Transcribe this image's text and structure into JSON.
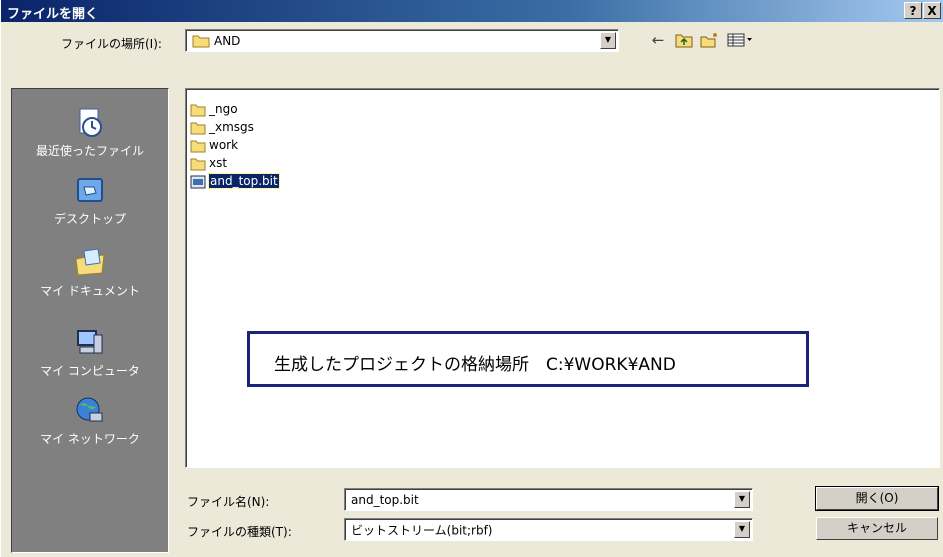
{
  "window": {
    "title": "ファイルを開く",
    "help_btn": "?",
    "close_btn": "X"
  },
  "location": {
    "label": "ファイルの場所(I):",
    "value": "AND"
  },
  "toolbar": {
    "back_icon": "←",
    "up_icon": "⇡",
    "new_folder_icon": "✳",
    "view_icon": "▦▾"
  },
  "places": [
    {
      "label": "最近使ったファイル",
      "icon": "recent-icon"
    },
    {
      "label": "デスクトップ",
      "icon": "desktop-icon"
    },
    {
      "label": "マイ ドキュメント",
      "icon": "documents-icon"
    },
    {
      "label": "マイ コンピュータ",
      "icon": "computer-icon"
    },
    {
      "label": "マイ ネットワーク",
      "icon": "network-icon"
    }
  ],
  "files": [
    {
      "name": "_ngo",
      "type": "folder"
    },
    {
      "name": "_xmsgs",
      "type": "folder"
    },
    {
      "name": "work",
      "type": "folder"
    },
    {
      "name": "xst",
      "type": "folder"
    },
    {
      "name": "and_top.bit",
      "type": "file",
      "selected": true
    }
  ],
  "annotation": "生成したプロジェクトの格納場所　C:¥WORK¥AND",
  "filename": {
    "label": "ファイル名(N):",
    "value": "and_top.bit"
  },
  "filetype": {
    "label": "ファイルの種類(T):",
    "value": "ビットストリーム(bit;rbf)"
  },
  "buttons": {
    "open": "開く(O)",
    "cancel": "キャンセル"
  }
}
